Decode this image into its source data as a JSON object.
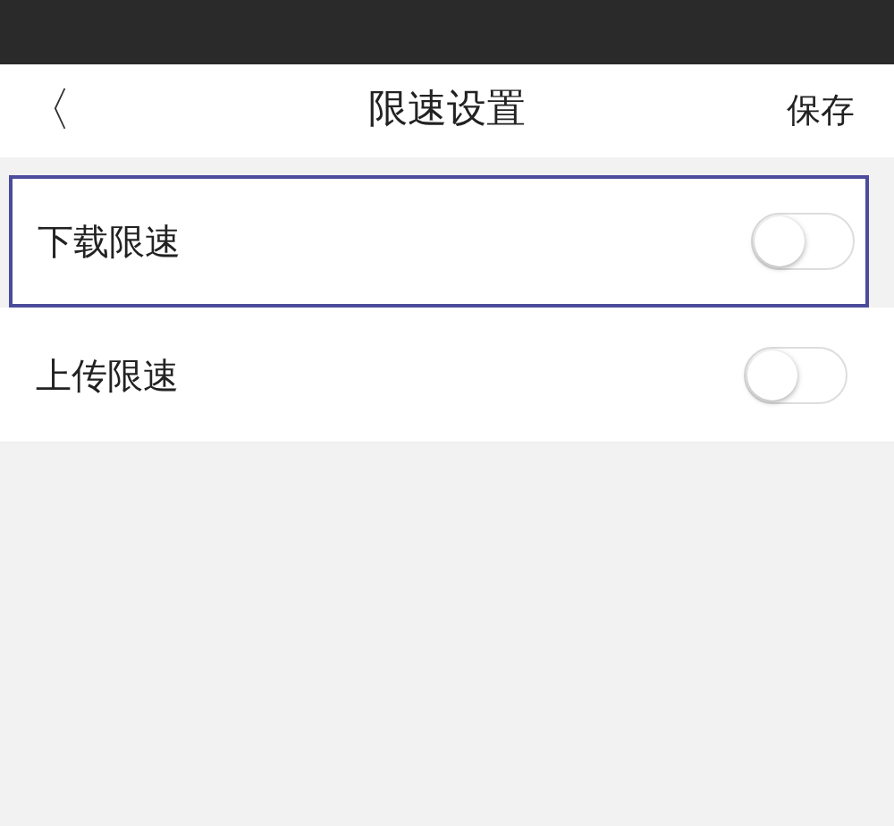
{
  "header": {
    "back": "〈",
    "title": "限速设置",
    "action": "保存"
  },
  "settings": [
    {
      "label": "下载限速",
      "on": false,
      "highlighted": true
    },
    {
      "label": "上传限速",
      "on": false,
      "highlighted": false
    }
  ]
}
